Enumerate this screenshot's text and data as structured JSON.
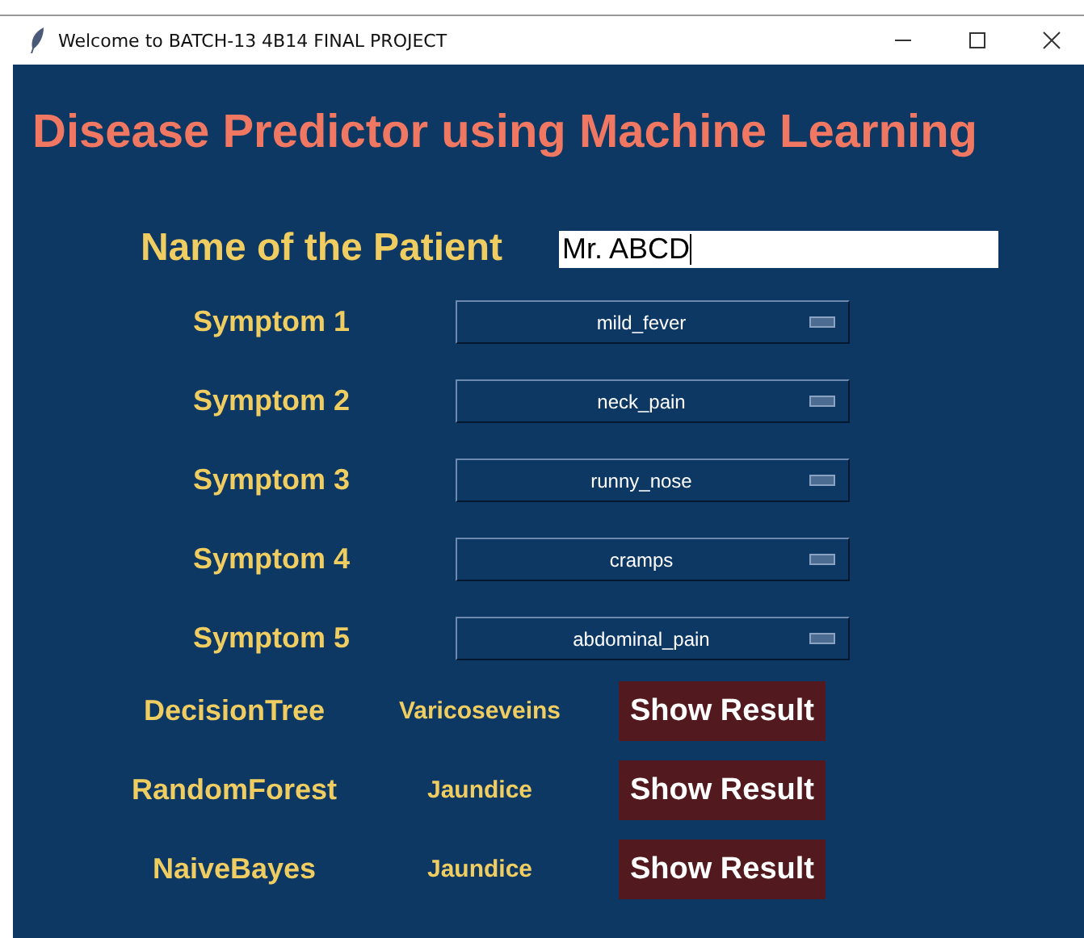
{
  "window": {
    "title": "Welcome to BATCH-13 4B14 FINAL PROJECT"
  },
  "heading": "Disease Predictor using Machine Learning",
  "patient": {
    "label": "Name of the Patient",
    "value": "Mr. ABCD"
  },
  "symptoms": [
    {
      "label": "Symptom 1",
      "value": "mild_fever"
    },
    {
      "label": "Symptom 2",
      "value": "neck_pain"
    },
    {
      "label": "Symptom 3",
      "value": "runny_nose"
    },
    {
      "label": "Symptom 4",
      "value": "cramps"
    },
    {
      "label": "Symptom 5",
      "value": "abdominal_pain"
    }
  ],
  "results": [
    {
      "model": "DecisionTree",
      "prediction": "Varicoseveins",
      "button": "Show Result"
    },
    {
      "model": "RandomForest",
      "prediction": "Jaundice",
      "button": "Show Result"
    },
    {
      "model": "NaiveBayes",
      "prediction": "Jaundice",
      "button": "Show Result"
    }
  ]
}
